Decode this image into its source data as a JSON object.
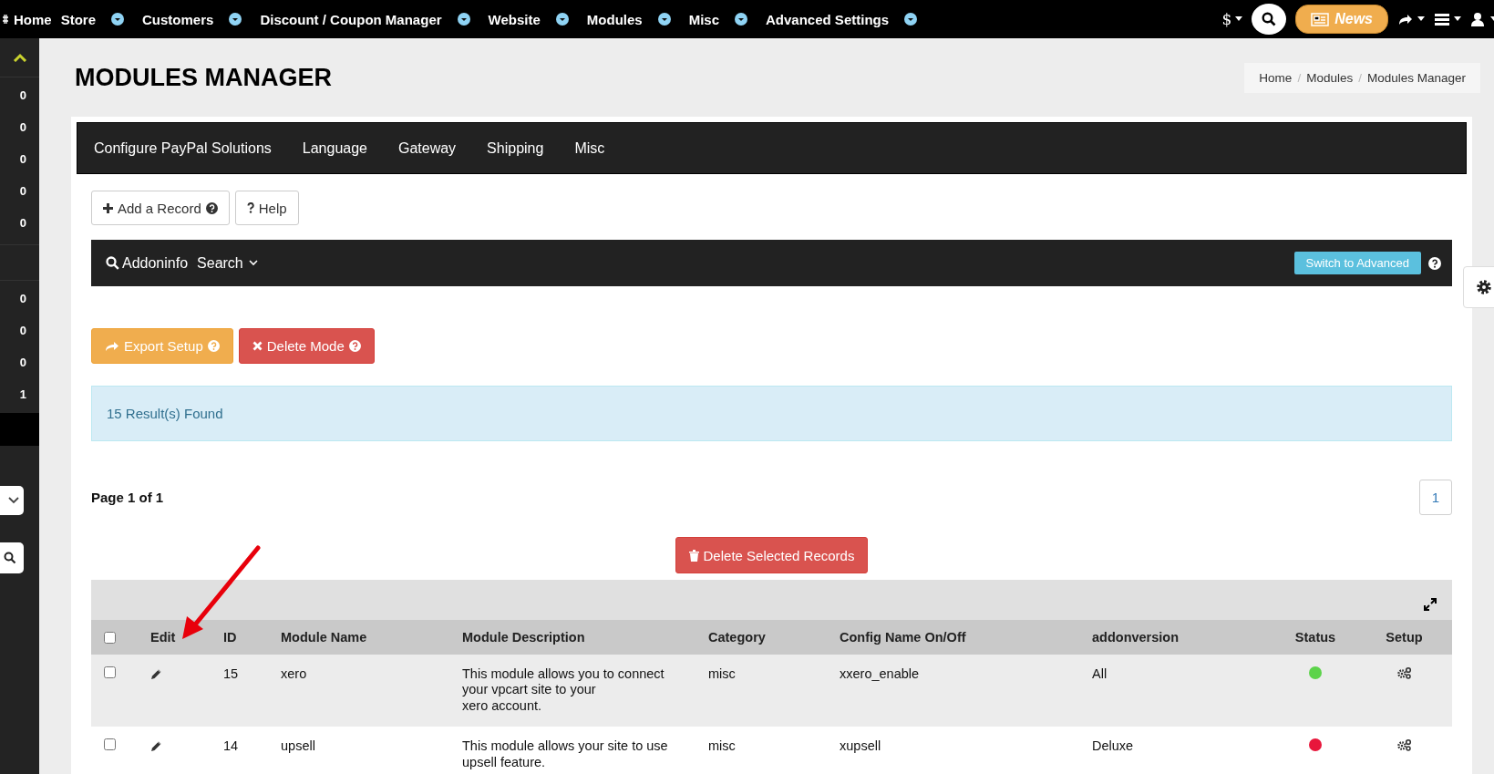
{
  "top_nav": {
    "items": [
      {
        "label": "Home",
        "dropdown": false
      },
      {
        "label": "Store",
        "dropdown": true
      },
      {
        "label": "Customers",
        "dropdown": true
      },
      {
        "label": "Discount / Coupon Manager",
        "dropdown": true
      },
      {
        "label": "Website",
        "dropdown": true
      },
      {
        "label": "Modules",
        "dropdown": true
      },
      {
        "label": "Misc",
        "dropdown": true
      },
      {
        "label": "Advanced Settings",
        "dropdown": true
      }
    ],
    "currency": "$",
    "news": "News"
  },
  "sidebar": {
    "groups": [
      [
        "0",
        "0",
        "0",
        "0",
        "0"
      ],
      [
        "0",
        "0",
        "0",
        "1"
      ]
    ]
  },
  "page_title": "MODULES MANAGER",
  "breadcrumb": {
    "separator": "/",
    "items": [
      "Home",
      "Modules",
      "Modules Manager"
    ]
  },
  "tabs": [
    {
      "label": "Configure PayPal Solutions"
    },
    {
      "label": "Language"
    },
    {
      "label": "Gateway"
    },
    {
      "label": "Shipping"
    },
    {
      "label": "Misc"
    }
  ],
  "toolbar": {
    "add": "Add a Record",
    "help": "Help"
  },
  "search_bar": {
    "title": "Addoninfo",
    "search": "Search",
    "switch": "Switch to Advanced"
  },
  "actions": {
    "export": "Export Setup",
    "delete_mode": "Delete Mode"
  },
  "alert": "15 Result(s) Found",
  "pagination": {
    "label": "Page 1 of 1",
    "pages": [
      {
        "label": "1",
        "selected": true
      }
    ]
  },
  "delete_selected": "Delete Selected Records",
  "table": {
    "select_all_checked": false,
    "columns": [
      "Edit",
      "ID",
      "Module Name",
      "Module Description",
      "Category",
      "Config Name On/Off",
      "addonversion",
      "Status",
      "Setup"
    ],
    "rows": [
      {
        "checked": false,
        "id": "15",
        "name": "xero",
        "description": [
          "This module allows you to connect",
          "your vpcart site to your",
          "xero account."
        ],
        "category": "misc",
        "config": "xxero_enable",
        "version": "All",
        "color": "#5cd34a"
      },
      {
        "checked": false,
        "id": "14",
        "name": "upsell",
        "description": [
          "This module allows your site to use",
          "upsell feature."
        ],
        "category": "misc",
        "config": "xupsell",
        "version": "Deluxe",
        "color": "#e8163b"
      }
    ]
  }
}
